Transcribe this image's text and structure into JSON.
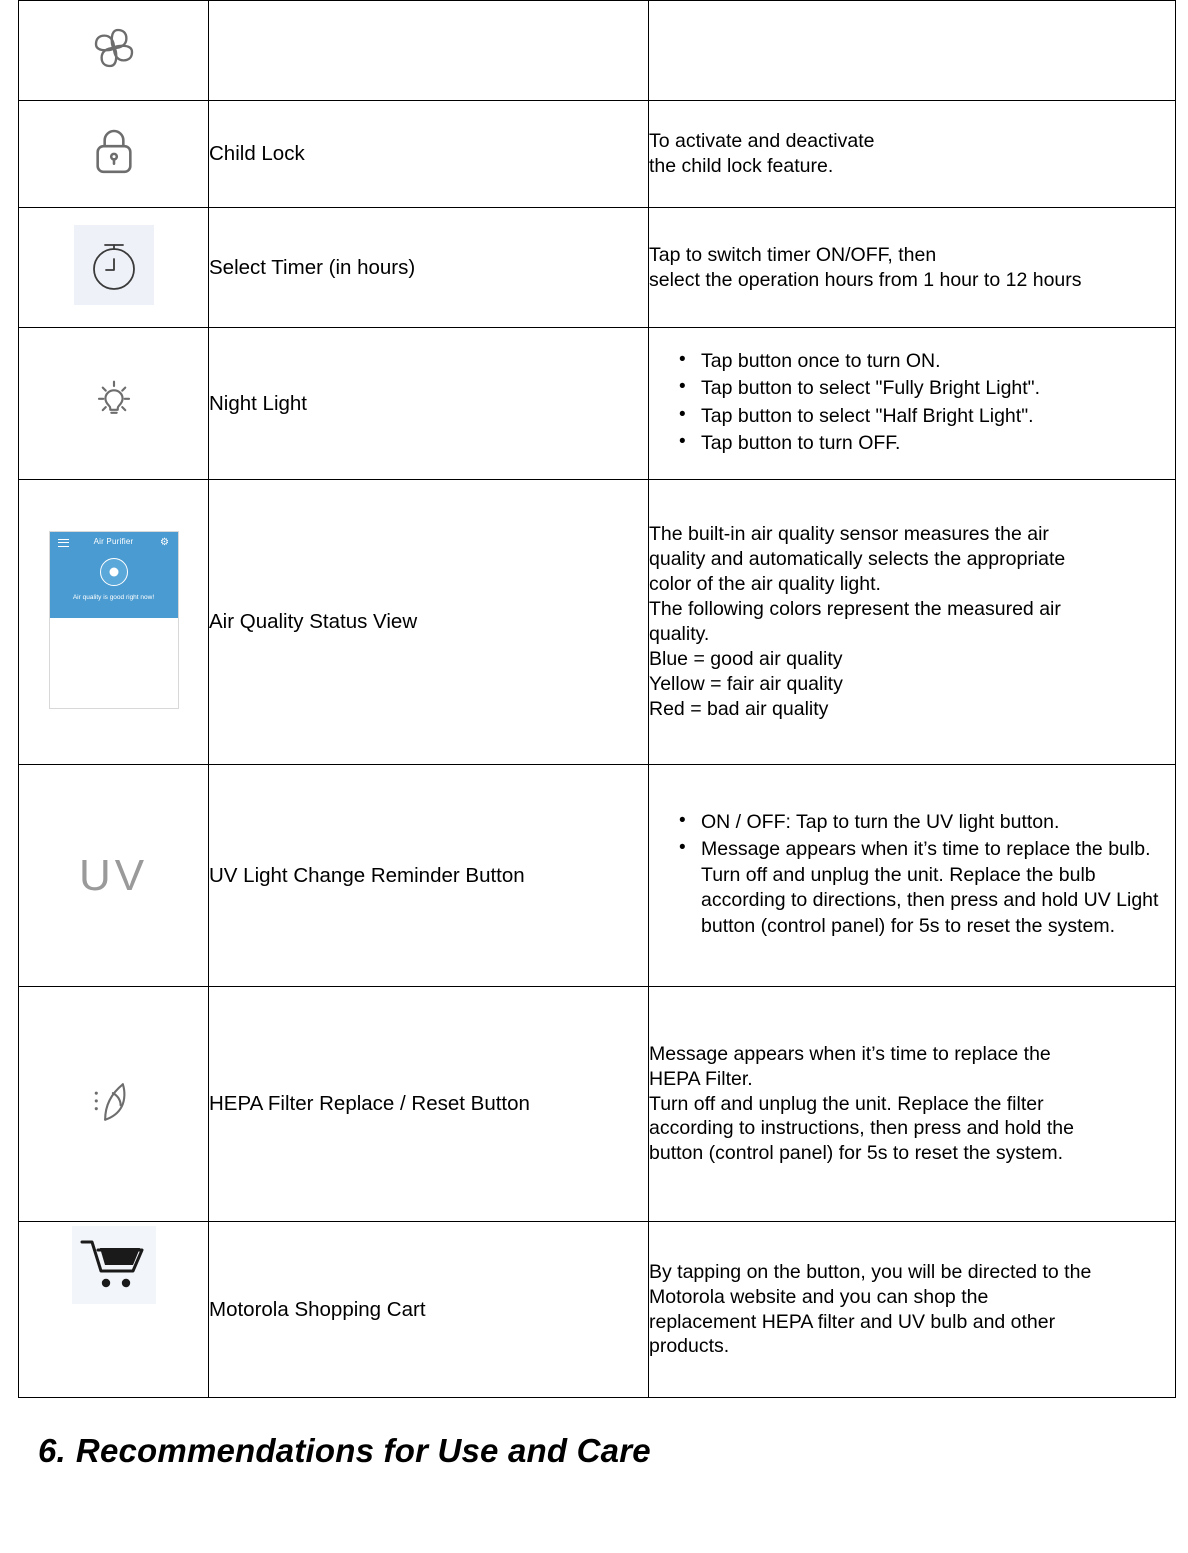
{
  "document": {
    "section_heading": {
      "number": "6.",
      "text": "Recommendations for Use and Care"
    }
  },
  "table": {
    "rows": [
      {
        "icon": "fan-icon",
        "name": "",
        "description_lines": [],
        "bullets": []
      },
      {
        "icon": "padlock-icon",
        "name": "Child Lock",
        "description_lines": [
          "To activate and deactivate",
          "the child lock feature."
        ],
        "bullets": []
      },
      {
        "icon": "timer-icon",
        "name": "Select Timer (in hours)",
        "description_lines": [
          "Tap to switch timer ON/OFF, then",
          "select the operation hours from 1 hour to 12 hours"
        ],
        "bullets": []
      },
      {
        "icon": "night-light-icon",
        "name": "Night Light",
        "description_lines": [],
        "bullets": [
          "Tap button once to turn ON.",
          "Tap button to select \"Fully Bright Light\".",
          "Tap button to select \"Half Bright Light\".",
          "Tap button to turn OFF."
        ]
      },
      {
        "icon": "phone-app-screenshot",
        "name": "Air Quality Status View",
        "description_lines": [
          "The built-in air quality sensor measures the air",
          "quality and automatically selects the appropriate",
          "color of the air quality light.",
          "The following colors represent the measured air",
          "quality.",
          "Blue = good air quality",
          "Yellow = fair air quality",
          "Red = bad air quality"
        ],
        "bullets": []
      },
      {
        "icon": "uv-text-icon",
        "name": "UV Light Change Reminder Button",
        "description_lines": [],
        "bullets": [
          "ON / OFF: Tap to turn the UV light button.",
          "Message appears when it’s time to replace the bulb. Turn off and unplug the unit. Replace the bulb according to directions, then press and hold UV Light button (control panel) for 5s to reset the system."
        ]
      },
      {
        "icon": "hepa-filter-icon",
        "name": "HEPA Filter Replace / Reset Button",
        "description_lines": [
          "Message appears when it’s time to replace the",
          "HEPA Filter.",
          "Turn off and unplug the unit. Replace the filter",
          "according to instructions, then press and hold the",
          "button (control panel) for 5s to reset the system."
        ],
        "bullets": []
      },
      {
        "icon": "shopping-cart-icon",
        "name": "Motorola Shopping Cart",
        "description_lines": [
          "By tapping on the button, you will be directed to the",
          "Motorola website and you can shop the",
          "replacement HEPA filter and UV bulb and other",
          "products."
        ],
        "bullets": []
      }
    ]
  },
  "app_screenshot": {
    "title": "Air Purifier",
    "subtitle": "Air quality is good right now!",
    "menu_icon": "hamburger-icon",
    "settings_icon": "gear-icon",
    "header_color": "#4a9bd1"
  }
}
